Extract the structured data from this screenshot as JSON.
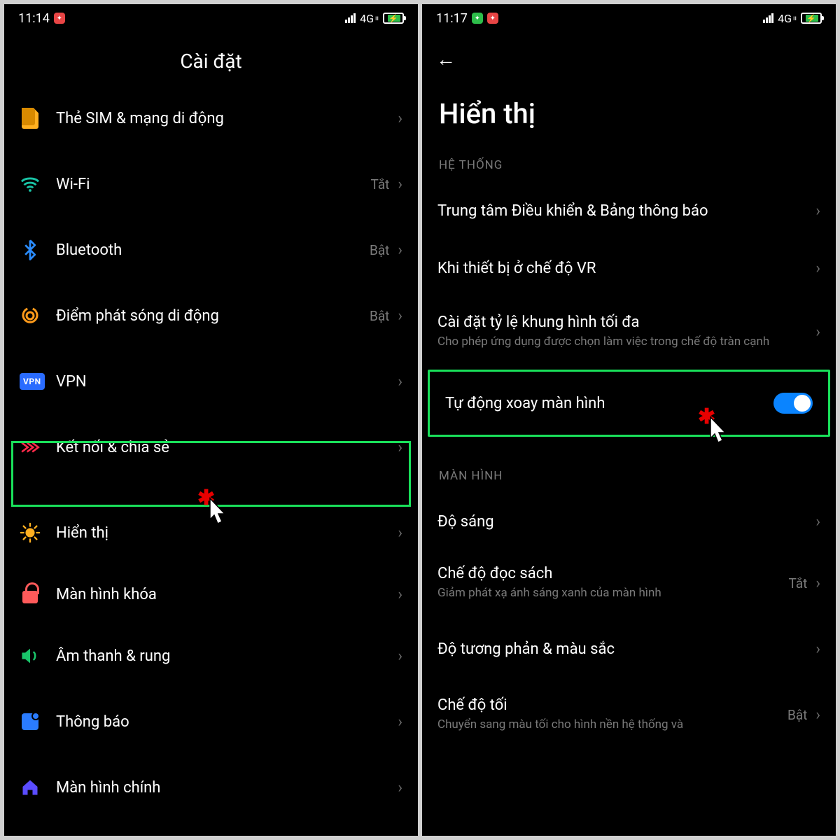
{
  "left": {
    "status": {
      "time": "11:14",
      "net": "4G"
    },
    "title": "Cài đặt",
    "items": [
      {
        "icon": "sim",
        "label": "Thẻ SIM & mạng di động",
        "value": ""
      },
      {
        "icon": "wifi",
        "label": "Wi-Fi",
        "value": "Tắt"
      },
      {
        "icon": "bluetooth",
        "label": "Bluetooth",
        "value": "Bật"
      },
      {
        "icon": "hotspot",
        "label": "Điểm phát sóng di động",
        "value": "Bật"
      },
      {
        "icon": "vpn",
        "label": "VPN",
        "value": ""
      },
      {
        "icon": "share",
        "label": "Kết nối & chia sẻ",
        "value": ""
      },
      {
        "icon": "display",
        "label": "Hiển thị",
        "value": ""
      },
      {
        "icon": "lock",
        "label": "Màn hình khóa",
        "value": ""
      },
      {
        "icon": "sound",
        "label": "Âm thanh & rung",
        "value": ""
      },
      {
        "icon": "notify",
        "label": "Thông báo",
        "value": ""
      },
      {
        "icon": "home",
        "label": "Màn hình chính",
        "value": ""
      }
    ]
  },
  "right": {
    "status": {
      "time": "11:17",
      "net": "4G"
    },
    "title": "Hiển thị",
    "section1": "HỆ THỐNG",
    "r1": {
      "label": "Trung tâm Điều khiển & Bảng thông báo"
    },
    "r2": {
      "label": "Khi thiết bị ở chế độ VR"
    },
    "r3": {
      "label": "Cài đặt tỷ lệ khung hình tối đa",
      "sub": "Cho phép ứng dụng được chọn làm việc trong chế độ tràn cạnh"
    },
    "r4": {
      "label": "Tự động xoay màn hình",
      "toggle": true
    },
    "section2": "MÀN HÌNH",
    "r5": {
      "label": "Độ sáng"
    },
    "r6": {
      "label": "Chế độ đọc sách",
      "sub": "Giảm phát xạ ánh sáng xanh của màn hình",
      "value": "Tắt"
    },
    "r7": {
      "label": "Độ tương phản & màu sắc"
    },
    "r8": {
      "label": "Chế độ tối",
      "sub": "Chuyển sang màu tối cho hình nền hệ thống và",
      "value": "Bật"
    }
  }
}
